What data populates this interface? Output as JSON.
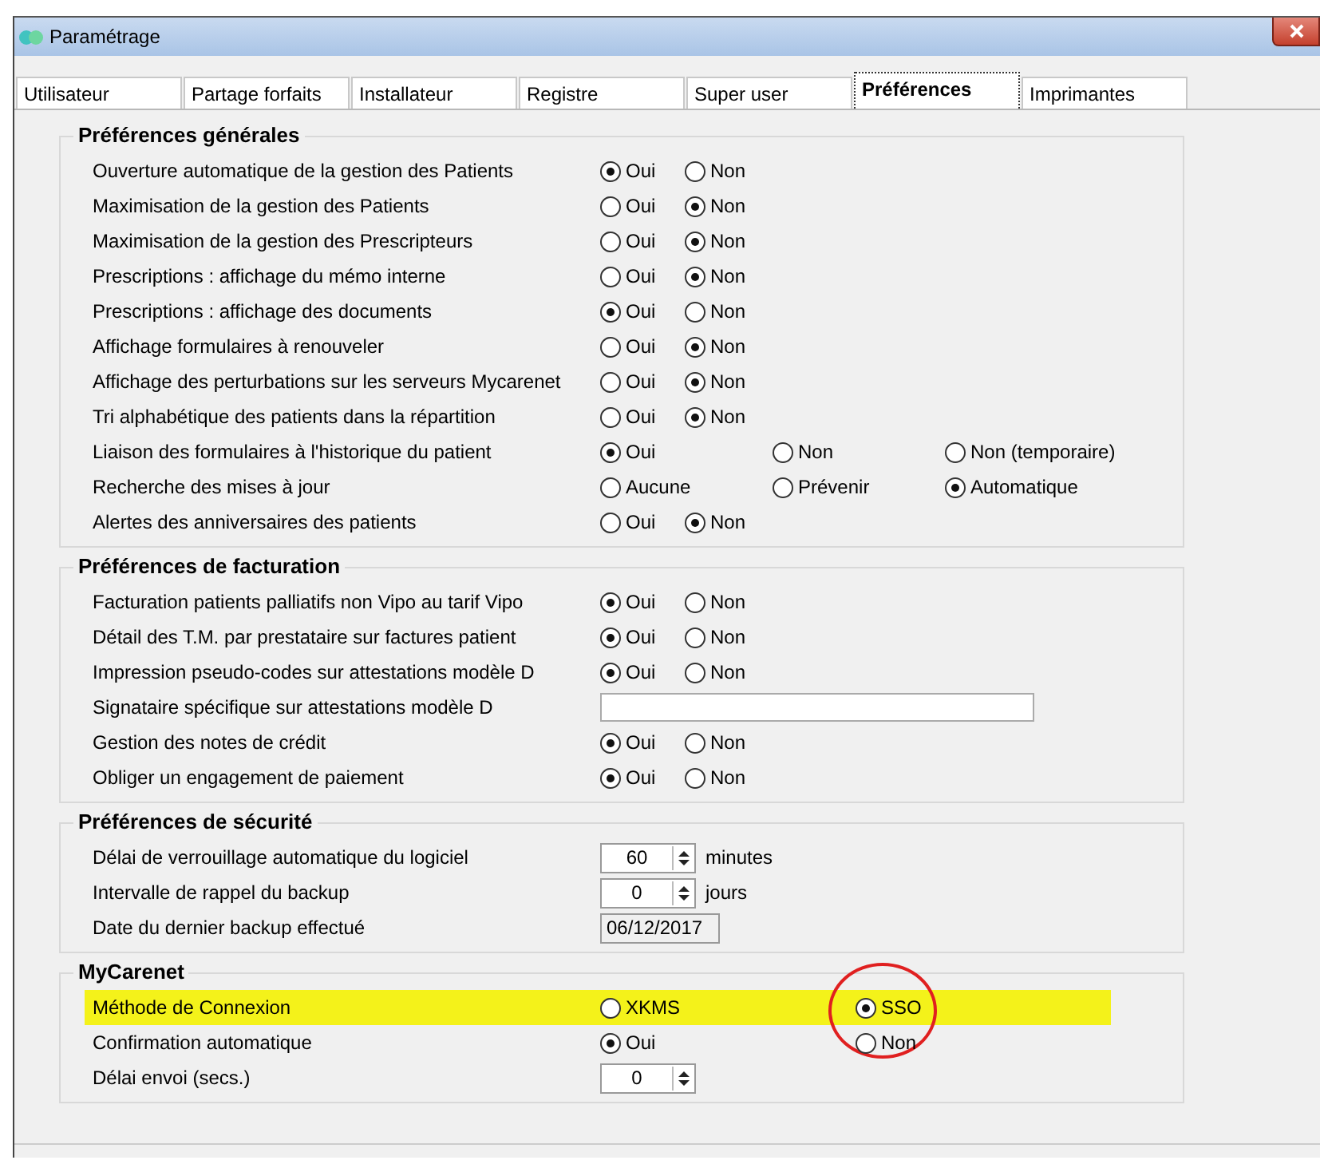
{
  "window": {
    "title": "Paramétrage"
  },
  "tabs": [
    {
      "label": "Utilisateur",
      "selected": false
    },
    {
      "label": "Partage forfaits",
      "selected": false
    },
    {
      "label": "Installateur",
      "selected": false
    },
    {
      "label": "Registre",
      "selected": false
    },
    {
      "label": "Super user",
      "selected": false
    },
    {
      "label": "Préférences",
      "selected": true
    },
    {
      "label": "Imprimantes",
      "selected": false
    }
  ],
  "groups": [
    {
      "title": "Préférences générales",
      "rows": [
        {
          "kind": "radio",
          "label": "Ouverture automatique de la gestion des Patients",
          "options": [
            {
              "label": "Oui",
              "selected": true
            },
            {
              "label": "Non",
              "selected": false
            }
          ]
        },
        {
          "kind": "radio",
          "label": "Maximisation de la gestion des Patients",
          "options": [
            {
              "label": "Oui",
              "selected": false
            },
            {
              "label": "Non",
              "selected": true
            }
          ]
        },
        {
          "kind": "radio",
          "label": "Maximisation de la gestion des Prescripteurs",
          "options": [
            {
              "label": "Oui",
              "selected": false
            },
            {
              "label": "Non",
              "selected": true
            }
          ]
        },
        {
          "kind": "radio",
          "label": "Prescriptions : affichage du mémo interne",
          "options": [
            {
              "label": "Oui",
              "selected": false
            },
            {
              "label": "Non",
              "selected": true
            }
          ]
        },
        {
          "kind": "radio",
          "label": "Prescriptions : affichage des documents",
          "options": [
            {
              "label": "Oui",
              "selected": true
            },
            {
              "label": "Non",
              "selected": false
            }
          ]
        },
        {
          "kind": "radio",
          "label": "Affichage formulaires à renouveler",
          "options": [
            {
              "label": "Oui",
              "selected": false
            },
            {
              "label": "Non",
              "selected": true
            }
          ]
        },
        {
          "kind": "radio",
          "label": "Affichage des perturbations sur les serveurs Mycarenet",
          "options": [
            {
              "label": "Oui",
              "selected": false
            },
            {
              "label": "Non",
              "selected": true
            }
          ]
        },
        {
          "kind": "radio",
          "label": "Tri alphabétique des patients dans la répartition",
          "options": [
            {
              "label": "Oui",
              "selected": false
            },
            {
              "label": "Non",
              "selected": true
            }
          ]
        },
        {
          "kind": "radio",
          "label": "Liaison des formulaires à l'historique du patient",
          "options": [
            {
              "label": "Oui",
              "selected": true
            },
            {
              "label": "Non",
              "selected": false
            },
            {
              "label": "Non (temporaire)",
              "selected": false
            }
          ]
        },
        {
          "kind": "radio",
          "label": "Recherche des mises à jour",
          "options": [
            {
              "label": "Aucune",
              "selected": false
            },
            {
              "label": "Prévenir",
              "selected": false
            },
            {
              "label": "Automatique",
              "selected": true
            }
          ]
        },
        {
          "kind": "radio",
          "label": "Alertes des anniversaires des patients",
          "options": [
            {
              "label": "Oui",
              "selected": false
            },
            {
              "label": "Non",
              "selected": true
            }
          ]
        }
      ]
    },
    {
      "title": "Préférences de facturation",
      "rows": [
        {
          "kind": "radio",
          "label": "Facturation patients palliatifs non Vipo au tarif Vipo",
          "options": [
            {
              "label": "Oui",
              "selected": true
            },
            {
              "label": "Non",
              "selected": false
            }
          ]
        },
        {
          "kind": "radio",
          "label": "Détail des T.M. par prestataire sur factures patient",
          "options": [
            {
              "label": "Oui",
              "selected": true
            },
            {
              "label": "Non",
              "selected": false
            }
          ]
        },
        {
          "kind": "radio",
          "label": "Impression pseudo-codes sur attestations modèle D",
          "options": [
            {
              "label": "Oui",
              "selected": true
            },
            {
              "label": "Non",
              "selected": false
            }
          ]
        },
        {
          "kind": "text",
          "label": "Signataire spécifique sur attestations modèle D"
        },
        {
          "kind": "radio",
          "label": "Gestion des notes de crédit",
          "options": [
            {
              "label": "Oui",
              "selected": true
            },
            {
              "label": "Non",
              "selected": false
            }
          ]
        },
        {
          "kind": "radio",
          "label": "Obliger un engagement de paiement",
          "options": [
            {
              "label": "Oui",
              "selected": true
            },
            {
              "label": "Non",
              "selected": false
            }
          ]
        }
      ]
    },
    {
      "title": "Préférences de sécurité",
      "rows": [
        {
          "kind": "spin",
          "label": "Délai de verrouillage automatique du logiciel",
          "value": "60",
          "unit": "minutes"
        },
        {
          "kind": "spin",
          "label": "Intervalle de rappel du backup",
          "value": "0",
          "unit": "jours"
        },
        {
          "kind": "date",
          "label": "Date du dernier backup effectué",
          "value": "06/12/2017"
        }
      ]
    },
    {
      "title": "MyCarenet",
      "rows": [
        {
          "kind": "radio",
          "label": "Méthode de Connexion",
          "highlighted": true,
          "options": [
            {
              "label": "XKMS",
              "selected": false
            },
            {
              "label": "SSO",
              "selected": true,
              "circled": true
            }
          ]
        },
        {
          "kind": "radio",
          "label": "Confirmation automatique",
          "options": [
            {
              "label": "Oui",
              "selected": true
            },
            {
              "label": "Non",
              "selected": false
            }
          ]
        },
        {
          "kind": "spin",
          "label": "Délai envoi (secs.)",
          "value": "0"
        }
      ]
    }
  ]
}
